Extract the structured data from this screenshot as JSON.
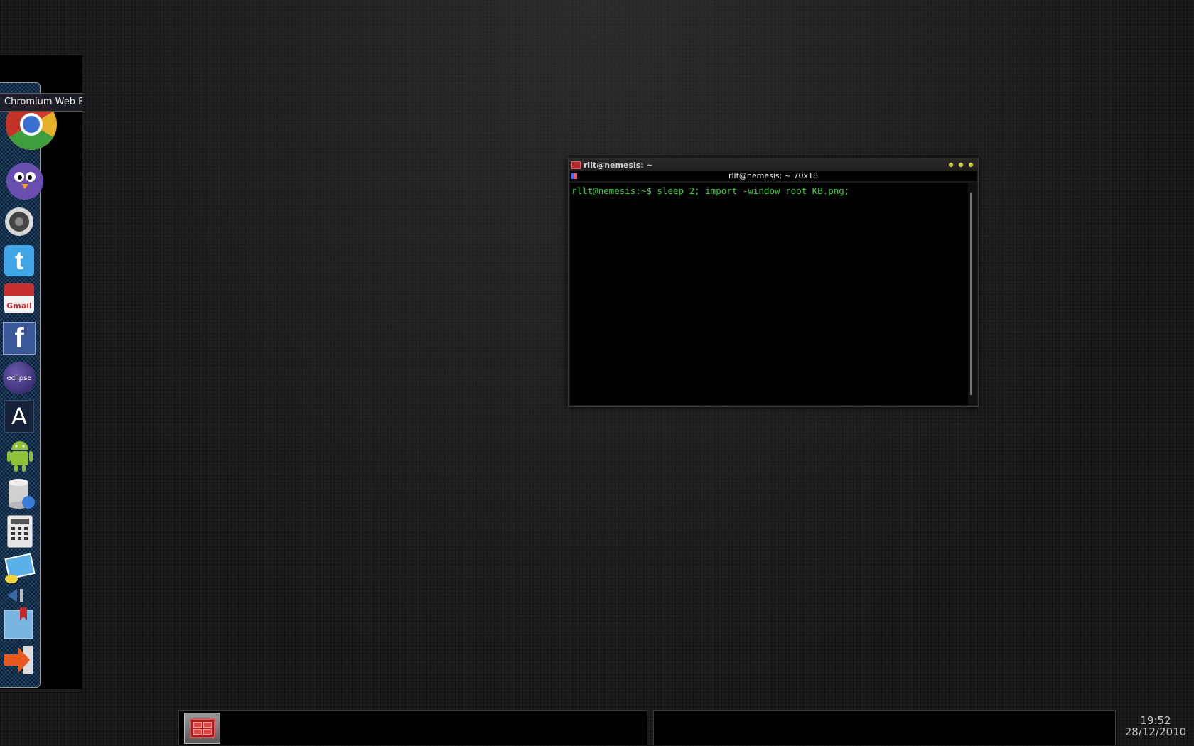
{
  "dock": {
    "tooltip": "Chromium Web B",
    "items": [
      {
        "name": "chromium",
        "glyph": ""
      },
      {
        "name": "pidgin",
        "glyph": ""
      },
      {
        "name": "volume",
        "glyph": ""
      },
      {
        "name": "twitter",
        "glyph": "t"
      },
      {
        "name": "gmail",
        "glyph": "Gmail"
      },
      {
        "name": "facebook",
        "glyph": "f"
      },
      {
        "name": "eclipse",
        "glyph": "eclipse"
      },
      {
        "name": "font-viewer",
        "glyph": "A"
      },
      {
        "name": "android",
        "glyph": ""
      },
      {
        "name": "database",
        "glyph": ""
      },
      {
        "name": "calculator",
        "glyph": ""
      },
      {
        "name": "image-viewer",
        "glyph": ""
      },
      {
        "name": "back",
        "glyph": ""
      },
      {
        "name": "bookmarks",
        "glyph": ""
      },
      {
        "name": "logout",
        "glyph": ""
      }
    ]
  },
  "terminal": {
    "title": "rllt@nemesis: ~",
    "info": "rllt@nemesis: ~ 70x18",
    "prompt_line": "rllt@nemesis:~$ sleep 2; import -window root KB.png;"
  },
  "clock": {
    "time": "19:52",
    "date": "28/12/2010"
  },
  "colors": {
    "terminal_text": "#3ed13e",
    "dock_accent": "#0a1e33",
    "close_buttons": "#d6d63a"
  }
}
